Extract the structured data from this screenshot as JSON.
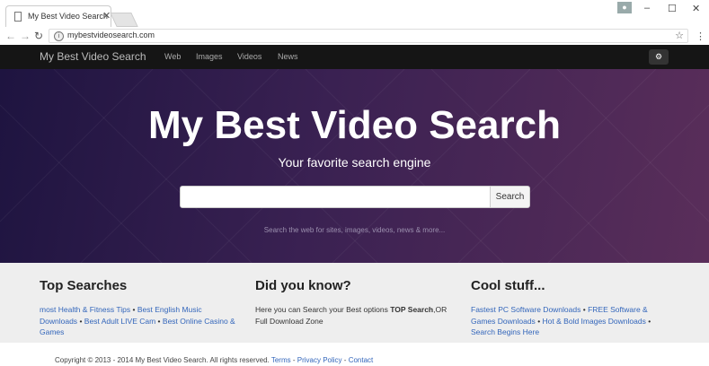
{
  "browser": {
    "tab_title": "My Best Video Search",
    "tab_close": "✕",
    "url": "mybestvideosearch.com",
    "window_controls": {
      "minimize": "–",
      "maximize": "☐",
      "close": "✕"
    }
  },
  "navbar": {
    "brand": "My Best Video Search",
    "links": [
      "Web",
      "Images",
      "Videos",
      "News"
    ]
  },
  "hero": {
    "title": "My Best Video Search",
    "subtitle": "Your favorite search engine",
    "search_placeholder": "",
    "search_button": "Search",
    "hint": "Search the web for sites, images, videos, news & more..."
  },
  "columns": [
    {
      "heading": "Top Searches",
      "items": [
        "most Health & Fitness Tips",
        "Best English Music Downloads",
        "Best Adult LIVE Cam",
        "Best Online Casino & Games"
      ]
    },
    {
      "heading": "Did you know?",
      "text_before": "Here you can Search your Best options ",
      "text_bold": "TOP Search",
      "text_after": ",OR Full Download Zone"
    },
    {
      "heading": "Cool stuff...",
      "items": [
        "Fastest PC Software Downloads",
        "FREE Software & Games Downloads",
        "Hot & Bold Images Downloads",
        "Search Begins Here"
      ]
    }
  ],
  "footer": {
    "copyright": "Copyright © 2013 - 2014 My Best Video Search. All rights reserved.",
    "links": [
      "Terms",
      "Privacy Policy",
      "Contact"
    ]
  },
  "colors": {
    "link": "#3366bb",
    "navbar_bg": "#151515",
    "hero_start": "#1e1440",
    "hero_end": "#5a2e5a"
  }
}
